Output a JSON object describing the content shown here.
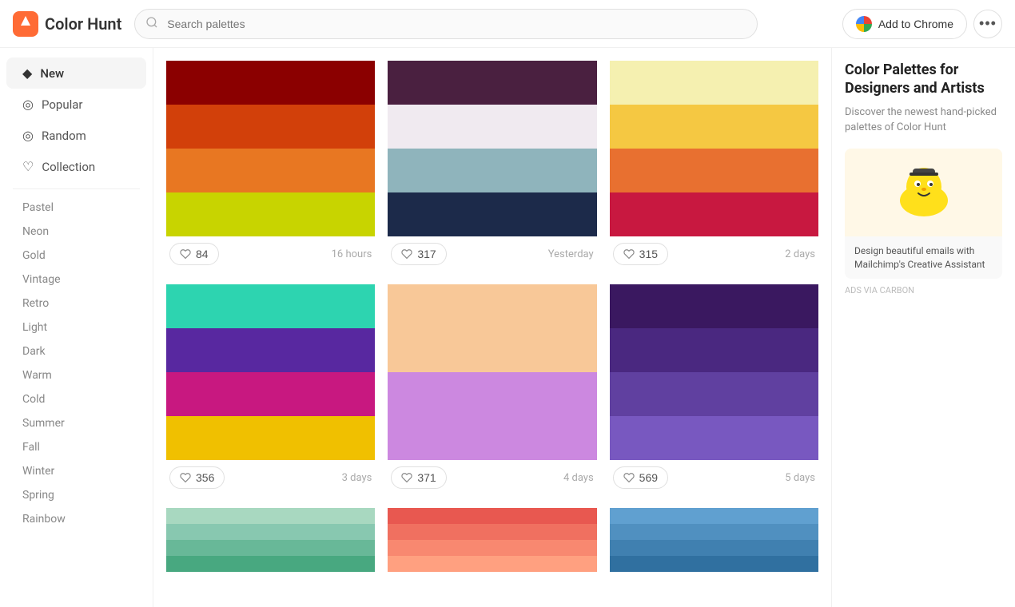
{
  "header": {
    "logo_text": "Color Hunt",
    "search_placeholder": "Search palettes",
    "add_to_chrome_label": "Add to Chrome",
    "more_button_label": "•••"
  },
  "sidebar": {
    "nav_items": [
      {
        "id": "new",
        "label": "New",
        "icon": "◆",
        "active": true
      },
      {
        "id": "popular",
        "label": "Popular",
        "icon": "◎"
      },
      {
        "id": "random",
        "label": "Random",
        "icon": "◎"
      },
      {
        "id": "collection",
        "label": "Collection",
        "icon": "♡"
      }
    ],
    "tags": [
      "Pastel",
      "Neon",
      "Gold",
      "Vintage",
      "Retro",
      "Light",
      "Dark",
      "Warm",
      "Cold",
      "Summer",
      "Fall",
      "Winter",
      "Spring",
      "Rainbow"
    ]
  },
  "palettes": [
    {
      "id": 1,
      "colors": [
        "#8B0000",
        "#D2400A",
        "#E87722",
        "#C8D400"
      ],
      "likes": 84,
      "time": "16 hours"
    },
    {
      "id": 2,
      "colors": [
        "#4A2040",
        "#F0EAF0",
        "#8FB4BC",
        "#1C2A4A"
      ],
      "likes": 317,
      "time": "Yesterday"
    },
    {
      "id": 3,
      "colors": [
        "#F5F0B0",
        "#F5C842",
        "#E87030",
        "#C81840"
      ],
      "likes": 315,
      "time": "2 days"
    },
    {
      "id": 4,
      "colors": [
        "#2DD4B0",
        "#5828A0",
        "#C81880",
        "#F0C000"
      ],
      "likes": 356,
      "time": "3 days"
    },
    {
      "id": 5,
      "colors": [
        "#F8C898",
        "#F8C898",
        "#CC88E0",
        "#CC88E0"
      ],
      "likes": 371,
      "time": "4 days"
    },
    {
      "id": 6,
      "colors": [
        "#3A1860",
        "#4A2880",
        "#6040A0",
        "#7858C0"
      ],
      "likes": 569,
      "time": "5 days"
    },
    {
      "id": 7,
      "colors": [
        "#A8D8C0",
        "#A8D8C0",
        "#A8D8C0",
        "#A8D8C0"
      ],
      "likes": null,
      "time": null
    },
    {
      "id": 8,
      "colors": [
        "#E85850",
        "#E85850",
        "#E85850",
        "#E85850"
      ],
      "likes": null,
      "time": null
    },
    {
      "id": 9,
      "colors": [
        "#60A0D0",
        "#60A0D0",
        "#60A0D0",
        "#60A0D0"
      ],
      "likes": null,
      "time": null
    }
  ],
  "right_sidebar": {
    "title": "Color Palettes for Designers and Artists",
    "description": "Discover the newest hand-picked palettes of Color Hunt",
    "ad": {
      "ad_text": "Design beautiful emails with Mailchimp's Creative Assistant",
      "ads_label": "ADS VIA CARBON"
    }
  }
}
